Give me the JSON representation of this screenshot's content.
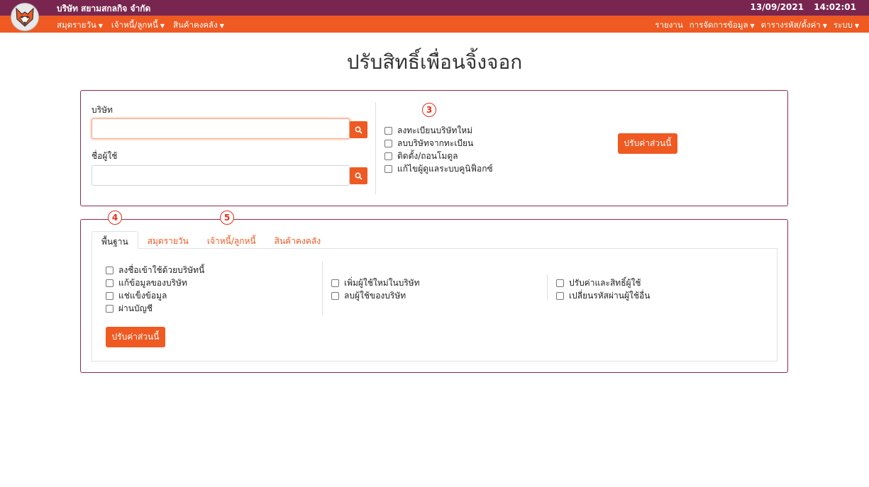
{
  "header": {
    "company": "บริษัท สยามสกลกิจ จำกัด",
    "date": "13/09/2021",
    "time": "14:02:01"
  },
  "nav": {
    "left": [
      "สมุดรายวัน",
      "เจ้าหนี้/ลูกหนี้",
      "สินค้าคงคลัง"
    ],
    "right_report": "รายงาน",
    "right": [
      "การจัดการข้อมูล",
      "ตารางรหัส/ตั้งค่า",
      "ระบบ"
    ]
  },
  "page": {
    "title": "ปรับสิทธิ์เพื่อนจิ้งจอก"
  },
  "form": {
    "company_label": "บริษัท",
    "company_value": "",
    "user_label": "ชื่อผู้ใช้",
    "user_value": ""
  },
  "company_perms": [
    "ลงทะเบียนบริษัทใหม่",
    "ลบบริษัทจากทะเบียน",
    "ติดตั้ง/ถอนโมดูล",
    "แก้ไขผู้ดูแลระบบคูนิฟ็อกซ์"
  ],
  "apply_label": "ปรับค่าส่วนนี้",
  "markers": [
    "3",
    "4",
    "5"
  ],
  "tabs": [
    "พื้นฐาน",
    "สมุดรายวัน",
    "เจ้าหนี้/ลูกหนี้",
    "สินค้าคงคลัง"
  ],
  "basic_perms": {
    "col1": [
      "ลงชื่อเข้าใช้ด้วยบริษัทนี้",
      "แก้ข้อมูลของบริษัท",
      "แช่แข็งข้อมูล",
      "ผ่านบัญชี"
    ],
    "col2": [
      "เพิ่มผู้ใช้ใหม่ในบริษัท",
      "ลบผู้ใช้ของบริษัท"
    ],
    "col3": [
      "ปรับค่าและสิทธิ์ผู้ใช้",
      "เปลี่ยนรหัสผ่านผู้ใช้อื่น"
    ]
  }
}
